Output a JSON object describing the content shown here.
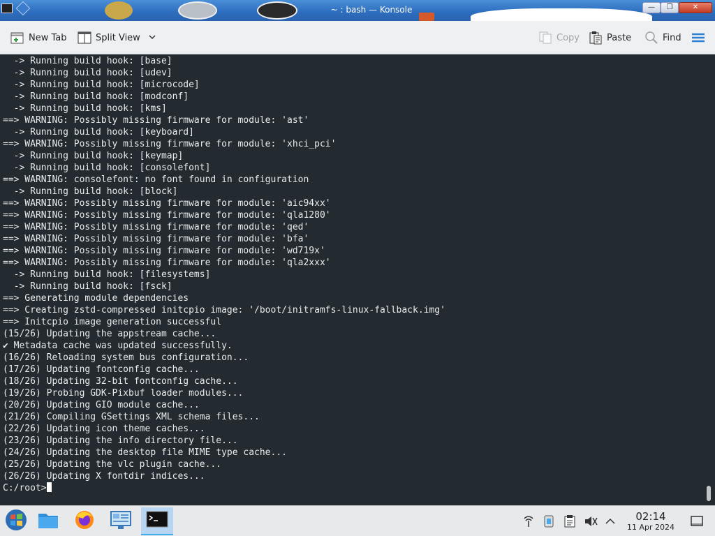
{
  "window": {
    "title": "~ : bash — Konsole",
    "minimize_glyph": "—",
    "maximize_glyph": "❐",
    "close_glyph": "✕"
  },
  "toolbar": {
    "new_tab": "New Tab",
    "split_view": "Split View",
    "copy": "Copy",
    "paste": "Paste",
    "find": "Find"
  },
  "terminal": {
    "lines": [
      "  -> Running build hook: [base]",
      "  -> Running build hook: [udev]",
      "  -> Running build hook: [microcode]",
      "  -> Running build hook: [modconf]",
      "  -> Running build hook: [kms]",
      "==> WARNING: Possibly missing firmware for module: 'ast'",
      "  -> Running build hook: [keyboard]",
      "==> WARNING: Possibly missing firmware for module: 'xhci_pci'",
      "  -> Running build hook: [keymap]",
      "  -> Running build hook: [consolefont]",
      "==> WARNING: consolefont: no font found in configuration",
      "  -> Running build hook: [block]",
      "==> WARNING: Possibly missing firmware for module: 'aic94xx'",
      "==> WARNING: Possibly missing firmware for module: 'qla1280'",
      "==> WARNING: Possibly missing firmware for module: 'qed'",
      "==> WARNING: Possibly missing firmware for module: 'bfa'",
      "==> WARNING: Possibly missing firmware for module: 'wd719x'",
      "==> WARNING: Possibly missing firmware for module: 'qla2xxx'",
      "  -> Running build hook: [filesystems]",
      "  -> Running build hook: [fsck]",
      "==> Generating module dependencies",
      "==> Creating zstd-compressed initcpio image: '/boot/initramfs-linux-fallback.img'",
      "==> Initcpio image generation successful",
      "(15/26) Updating the appstream cache...",
      "✔ Metadata cache was updated successfully.",
      "(16/26) Reloading system bus configuration...",
      "(17/26) Updating fontconfig cache...",
      "(18/26) Updating 32-bit fontconfig cache...",
      "(19/26) Probing GDK-Pixbuf loader modules...",
      "(20/26) Updating GIO module cache...",
      "(21/26) Compiling GSettings XML schema files...",
      "(22/26) Updating icon theme caches...",
      "(23/26) Updating the info directory file...",
      "(24/26) Updating the desktop file MIME type cache...",
      "(25/26) Updating the vlc plugin cache...",
      "(26/26) Updating X fontdir indices..."
    ],
    "prompt": "C:/root>"
  },
  "taskbar": {
    "apps": [
      {
        "name": "start-menu-icon"
      },
      {
        "name": "file-manager-icon"
      },
      {
        "name": "firefox-icon"
      },
      {
        "name": "system-settings-icon"
      },
      {
        "name": "konsole-icon"
      }
    ],
    "clock_time": "02:14",
    "clock_date": "11 Apr 2024"
  },
  "colors": {
    "terminal_bg": "#232a30",
    "terminal_fg": "#e8ecef",
    "titlebar": "#2e6fc0",
    "accent": "#3daee9"
  }
}
